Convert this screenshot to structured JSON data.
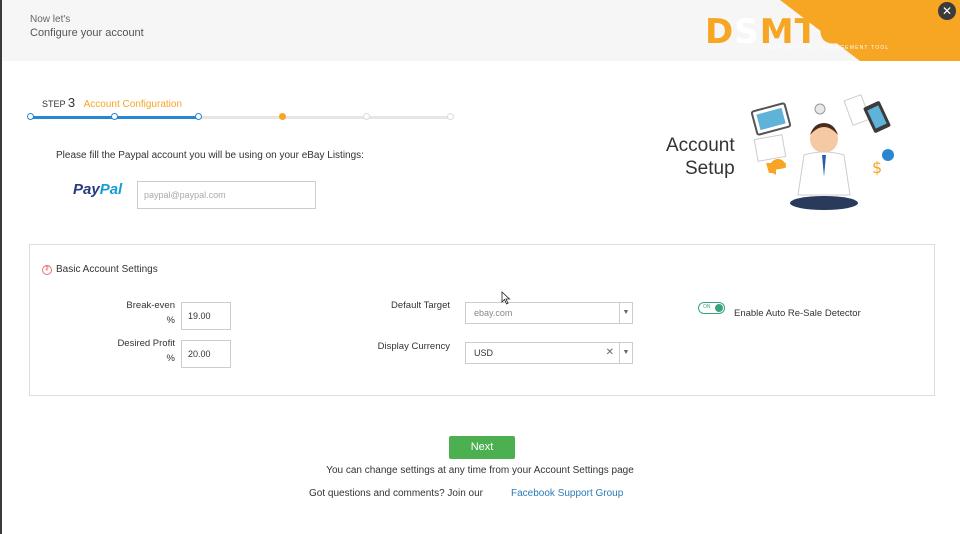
{
  "header": {
    "intro": "Now let's",
    "title": "Configure your account",
    "brand": "DSMTOOL",
    "brand_tagline": "DROP SHIPPING MANAGEMENT TOOL",
    "close_icon": "close-icon"
  },
  "steps": {
    "step_label": "STEP",
    "step_number": "3",
    "step_name": "Account Configuration",
    "total_steps": 6,
    "current_step": 3,
    "accent_color": "#f6a623",
    "progress_color": "#2a86d0"
  },
  "paypal": {
    "instruction": "Please fill the Paypal account you will be using on your eBay Listings:",
    "logo_pay": "Pay",
    "logo_pal": "Pal",
    "placeholder": "paypal@paypal.com"
  },
  "account_setup": {
    "line1": "Account",
    "line2": "Setup"
  },
  "basic_settings": {
    "title": "Basic Account Settings",
    "break_even_label": "Break-even",
    "break_even_unit": "%",
    "break_even_value": "19.00",
    "desired_profit_label": "Desired Profit",
    "desired_profit_unit": "%",
    "desired_profit_value": "20.00",
    "default_target_label": "Default Target",
    "default_target_value": "ebay.com",
    "display_currency_label": "Display Currency",
    "display_currency_value": "USD",
    "toggle_state": "ON",
    "toggle_label": "Enable Auto Re-Sale Detector",
    "toggle_color": "#3aa57a"
  },
  "footer": {
    "next_label": "Next",
    "next_color": "#4caf50",
    "note": "You can change settings at any time from your Account Settings page",
    "question": "Got questions and comments? Join our",
    "link_text": "Facebook Support Group"
  }
}
